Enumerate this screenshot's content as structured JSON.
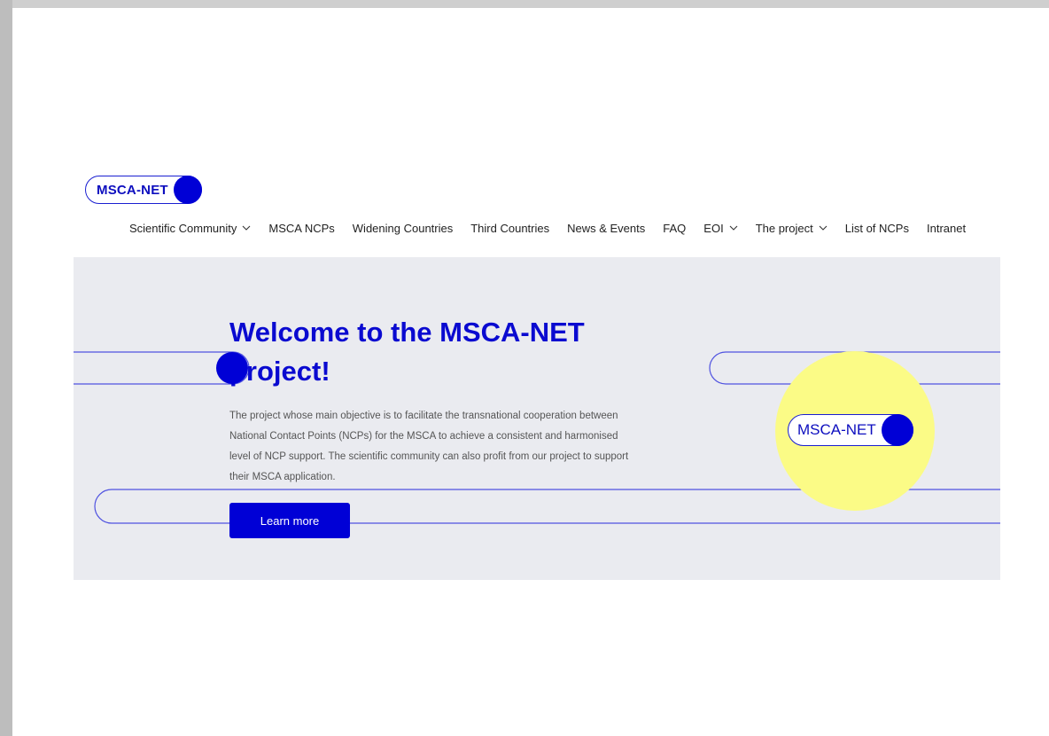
{
  "site": {
    "logo_text": "MSCA-NET"
  },
  "nav": {
    "items": [
      {
        "label": "Scientific Community",
        "dropdown": true
      },
      {
        "label": "MSCA NCPs",
        "dropdown": false
      },
      {
        "label": "Widening Countries",
        "dropdown": false
      },
      {
        "label": "Third Countries",
        "dropdown": false
      },
      {
        "label": "News & Events",
        "dropdown": false
      },
      {
        "label": "FAQ",
        "dropdown": false
      },
      {
        "label": "EOI",
        "dropdown": true
      },
      {
        "label": "The project",
        "dropdown": true
      },
      {
        "label": "List of NCPs",
        "dropdown": false
      },
      {
        "label": "Intranet",
        "dropdown": false
      }
    ]
  },
  "hero": {
    "title": "Welcome to the MSCA-NET project!",
    "body": "The project whose main objective is to facilitate the transnational cooperation between National Contact Points (NCPs) for the MSCA to achieve a consistent and harmonised level of NCP support. The scientific community can also profit from our project to support their MSCA application.",
    "cta_label": "Learn more",
    "badge_text": "MSCA-NET"
  },
  "colors": {
    "brand_blue": "#0000d6",
    "hero_bg": "#eaebf0",
    "highlight_yellow": "#fbfb86"
  }
}
